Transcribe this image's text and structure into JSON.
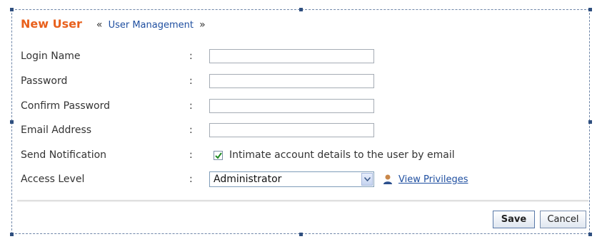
{
  "header": {
    "title": "New User",
    "crumb_left": "«",
    "crumb_link": "User Management",
    "crumb_right": "»"
  },
  "form": {
    "colon": ":",
    "login_name": {
      "label": "Login Name",
      "value": ""
    },
    "password": {
      "label": "Password",
      "value": ""
    },
    "confirm_password": {
      "label": "Confirm Password",
      "value": ""
    },
    "email_address": {
      "label": "Email Address",
      "value": ""
    },
    "send_notification": {
      "label": "Send Notification",
      "checked": true,
      "text": "Intimate account details to the user by email"
    },
    "access_level": {
      "label": "Access Level",
      "selected": "Administrator",
      "privileges_link": "View Privileges"
    }
  },
  "buttons": {
    "save": "Save",
    "cancel": "Cancel"
  },
  "colors": {
    "title": "#e8601c",
    "link": "#1f4fa0",
    "label": "#333333"
  },
  "icons": {
    "select_arrow": "chevron-down-icon",
    "privileges": "user-icon",
    "checkbox": "check-icon"
  }
}
